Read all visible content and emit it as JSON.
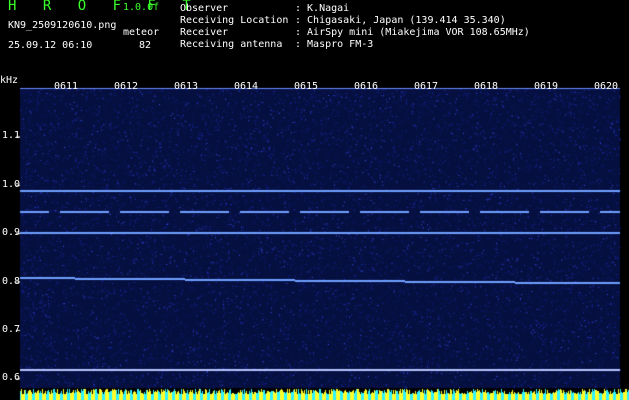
{
  "header": {
    "app_title": "H R O F F T",
    "version": "1.0.0f",
    "filename": "KN9_2509120610.png",
    "meteor_label": "meteor",
    "datetime": "25.09.12 06:10",
    "meteor_count": "82"
  },
  "info": [
    {
      "key": "Observer",
      "value": ": K.Nagai"
    },
    {
      "key": "Receiving Location",
      "value": ": Chigasaki, Japan (139.414 35.340)"
    },
    {
      "key": "Receiver",
      "value": ": AirSpy mini (Miakejima VOR 108.65MHz)"
    },
    {
      "key": "Receiving antenna",
      "value": ": Maspro FM-3"
    }
  ],
  "chart_data": {
    "type": "heatmap",
    "ylabel": "kHz",
    "y_ticks": [
      "1.1",
      "1.0",
      "0.9",
      "0.8",
      "0.7",
      "0.6"
    ],
    "x_ticks": [
      "0611",
      "0612",
      "0613",
      "0614",
      "0615",
      "0616",
      "0617",
      "0618",
      "0619",
      "0620"
    ],
    "ylim": [
      0.58,
      1.2
    ],
    "signal_lines_khz": [
      0.99,
      0.945,
      0.902,
      0.81,
      0.62
    ],
    "background_color": "#061040",
    "noise_color": "#1f2fbf",
    "line_color": "#6fa0ff",
    "strip_color_1": "#ffff2a",
    "strip_color_2": "#2ef2ff"
  }
}
